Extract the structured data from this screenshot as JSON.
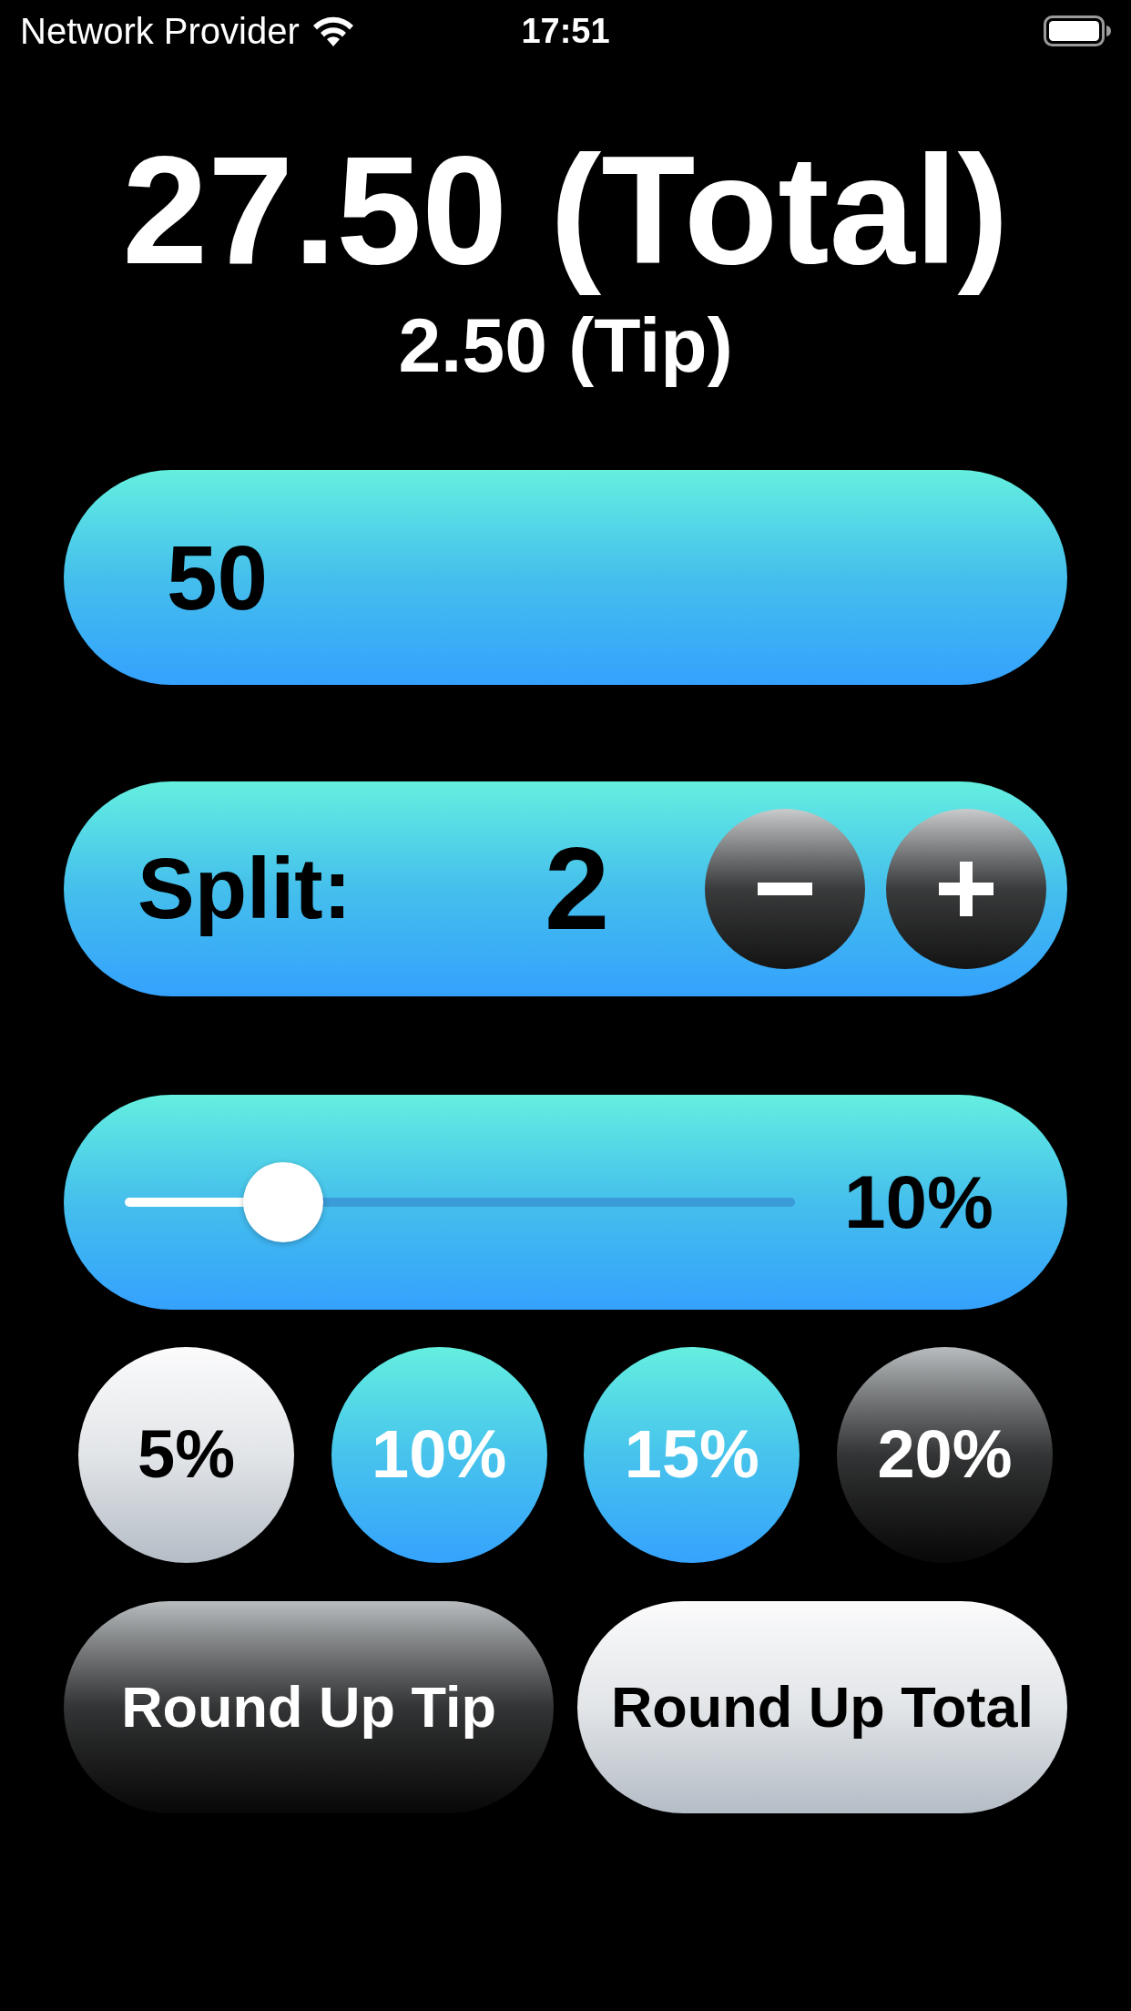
{
  "status_bar": {
    "carrier": "Network Provider",
    "time": "17:51"
  },
  "total": "27.50 (Total)",
  "tip": "2.50 (Tip)",
  "bill_field": {
    "value": "50"
  },
  "split": {
    "label": "Split:",
    "value": "2"
  },
  "tip_slider": {
    "level": 0.2,
    "reading": "10%"
  },
  "presets": [
    {
      "label": "5%",
      "kind": "silver"
    },
    {
      "label": "10%",
      "kind": "blue"
    },
    {
      "label": "15%",
      "kind": "blue"
    },
    {
      "label": "20%",
      "kind": "dark"
    }
  ],
  "round_buttons": [
    {
      "label": "Round Up Tip",
      "kind": "dark"
    },
    {
      "label": "Round Up Total",
      "kind": "silver"
    }
  ]
}
